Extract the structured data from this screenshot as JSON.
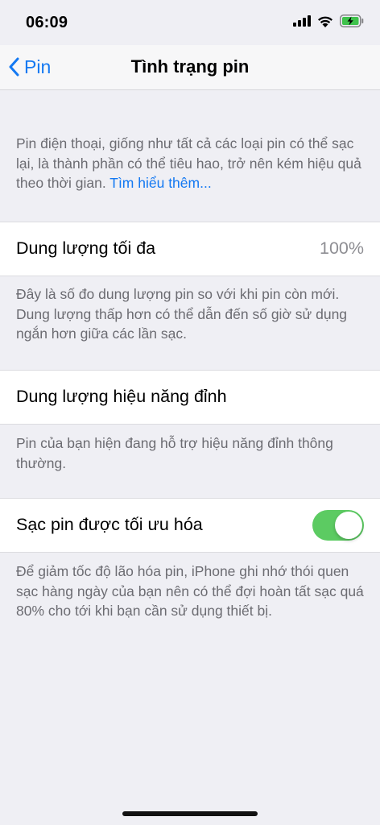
{
  "status_bar": {
    "time": "06:09",
    "icons": [
      "signal-icon",
      "wifi-icon",
      "battery-charging-icon"
    ]
  },
  "nav": {
    "back_label": "Pin",
    "title": "Tình trạng pin"
  },
  "intro": {
    "text": "Pin điện thoại, giống như tất cả các loại pin có thể sạc lại, là thành phần có thể tiêu hao, trở nên kém hiệu quả theo thời gian.",
    "link": "Tìm hiểu thêm..."
  },
  "max_capacity": {
    "label": "Dung lượng tối đa",
    "value": "100%",
    "description": "Đây là số đo dung lượng pin so với khi pin còn mới. Dung lượng thấp hơn có thể dẫn đến số giờ sử dụng ngắn hơn giữa các lần sạc."
  },
  "peak_performance": {
    "label": "Dung lượng hiệu năng đỉnh",
    "description": "Pin của bạn hiện đang hỗ trợ hiệu năng đỉnh thông thường."
  },
  "optimized_charging": {
    "label": "Sạc pin được tối ưu hóa",
    "enabled": true,
    "description": "Để giảm tốc độ lão hóa pin, iPhone ghi nhớ thói quen sạc hàng ngày của bạn nên có thể đợi hoàn tất sạc quá 80% cho tới khi bạn cần sử dụng thiết bị."
  },
  "colors": {
    "accent": "#1479f2",
    "toggle_on": "#5ccb62",
    "battery_charging": "#3fc24c",
    "background": "#efeff4"
  }
}
